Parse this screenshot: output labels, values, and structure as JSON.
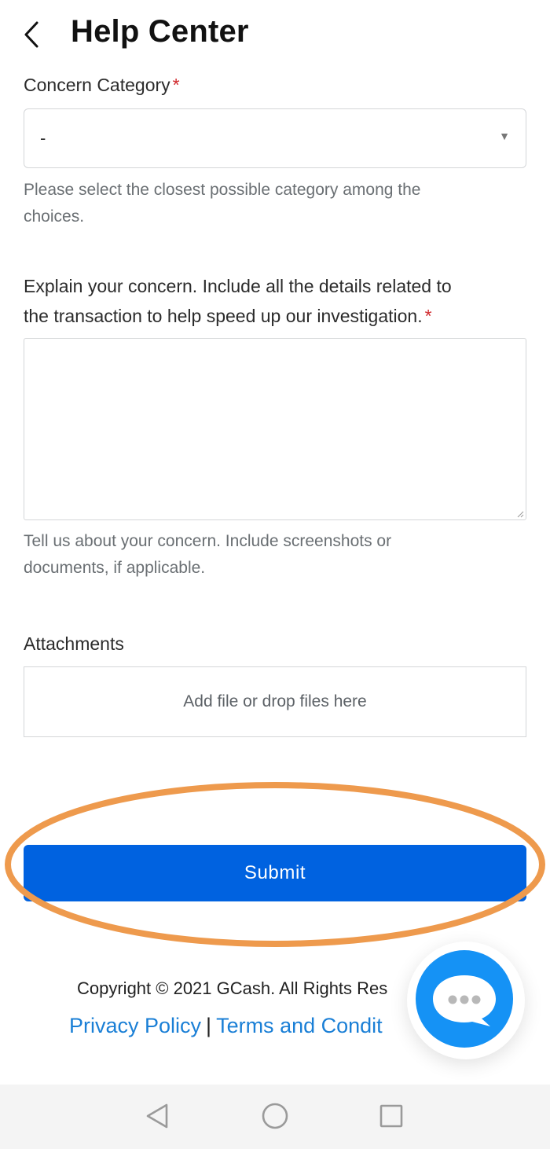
{
  "header": {
    "title": "Help Center"
  },
  "form": {
    "category": {
      "label": "Concern Category",
      "required_mark": "*",
      "selected_value": "-",
      "helper_line1": "Please select the closest possible category among the",
      "helper_line2": "choices."
    },
    "concern": {
      "label_line1": "Explain your concern. Include all the details related to",
      "label_line2": "the transaction to help speed up our investigation.",
      "required_mark": "*",
      "value": "",
      "helper_line1": "Tell us about your concern. Include screenshots or",
      "helper_line2": "documents, if applicable."
    },
    "attachments": {
      "label": "Attachments",
      "dropzone_text": "Add file or drop files here"
    },
    "submit_label": "Submit"
  },
  "footer": {
    "copyright": "Copyright © 2021 GCash. All Rights Res",
    "privacy_link": "Privacy Policy",
    "separator": "|",
    "terms_link": "Terms and Condit"
  },
  "colors": {
    "primary": "#0062e0",
    "link": "#1a7fd6",
    "required": "#d0282c",
    "highlight": "#ee9a4d",
    "chat_fab": "#1592f5"
  },
  "icons": {
    "back": "chevron-left-icon",
    "select_caret": "caret-down-icon",
    "chat": "chat-bubble-icon",
    "nav_back": "triangle-back-icon",
    "nav_home": "circle-home-icon",
    "nav_recents": "square-recents-icon"
  }
}
